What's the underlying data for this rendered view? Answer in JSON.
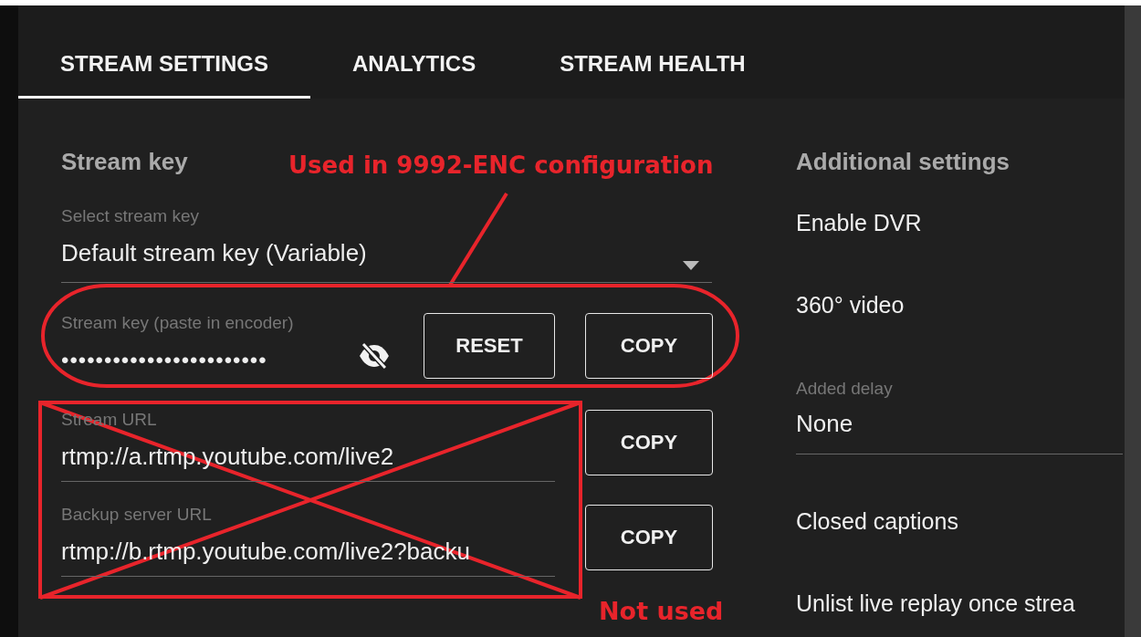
{
  "tabs": [
    {
      "label": "STREAM SETTINGS",
      "selected": true
    },
    {
      "label": "ANALYTICS",
      "selected": false
    },
    {
      "label": "STREAM HEALTH",
      "selected": false
    }
  ],
  "stream_key": {
    "heading": "Stream key",
    "select": {
      "label": "Select stream key",
      "value": "Default stream key (Variable)"
    },
    "key_field": {
      "label": "Stream key (paste in encoder)",
      "value": "••••••••••••••••••••••••",
      "masked": true
    },
    "buttons": [
      "RESET",
      "COPY"
    ]
  },
  "urls": [
    {
      "label": "Stream URL",
      "value": "rtmp://a.rtmp.youtube.com/live2",
      "button": "COPY"
    },
    {
      "label": "Backup server URL",
      "value": "rtmp://b.rtmp.youtube.com/live2?backu",
      "button": "COPY"
    }
  ],
  "additional_settings": {
    "heading": "Additional settings",
    "items": [
      {
        "kind": "option",
        "label": "Enable DVR"
      },
      {
        "kind": "option",
        "label": "360° video"
      },
      {
        "kind": "select",
        "label": "Added delay",
        "value": "None"
      },
      {
        "kind": "option",
        "label": "Closed captions"
      },
      {
        "kind": "option",
        "label": "Unlist live replay once strea"
      }
    ]
  },
  "annotations": [
    {
      "kind": "ellipse",
      "text": "Used in 9992-ENC configuration"
    },
    {
      "kind": "cross",
      "text": "Not used"
    }
  ]
}
